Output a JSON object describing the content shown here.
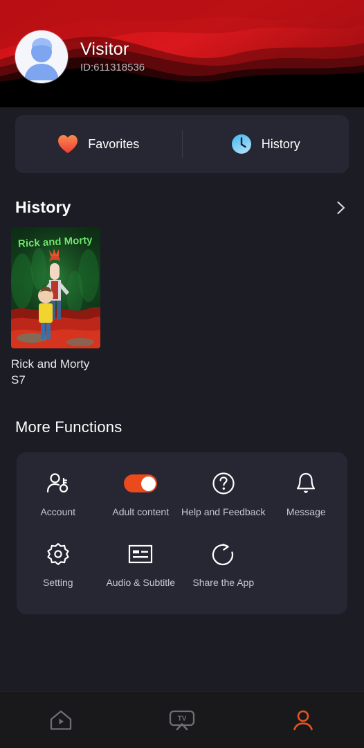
{
  "header": {
    "profile_name": "Visitor",
    "profile_id": "ID:611318536",
    "avatar_icon": "person-avatar-icon",
    "wave_colors": [
      "#d31116",
      "#b00f13",
      "#7d0c10",
      "#4a0709",
      "#000000"
    ]
  },
  "tabs": [
    {
      "label": "Favorites",
      "icon": "heart-icon",
      "color": "#f4623a"
    },
    {
      "label": "History",
      "icon": "clock-icon",
      "color": "#63c6f0"
    }
  ],
  "history_section": {
    "title": "History",
    "chevron_icon": "chevron-right-icon",
    "items": [
      {
        "title": "Rick and Morty S7",
        "poster_alt": "rick-and-morty-poster"
      }
    ]
  },
  "more_functions": {
    "title": "More Functions",
    "row1": [
      {
        "label": "Account",
        "icon": "person-key-icon",
        "type": "icon"
      },
      {
        "label": "Adult content",
        "icon": "toggle-switch-icon",
        "type": "toggle",
        "state": "on",
        "accent": "#ea4a1c"
      },
      {
        "label": "Help and Feedback",
        "icon": "question-circle-icon",
        "type": "icon"
      },
      {
        "label": "Message",
        "icon": "bell-icon",
        "type": "icon"
      }
    ],
    "row2": [
      {
        "label": "Setting",
        "icon": "gear-icon",
        "type": "icon"
      },
      {
        "label": "Audio & Subtitle",
        "icon": "subtitle-card-icon",
        "type": "icon"
      },
      {
        "label": "Share the App",
        "icon": "share-circle-arrow-icon",
        "type": "icon"
      }
    ]
  },
  "bottom_nav": [
    {
      "name": "home",
      "icon": "home-play-icon",
      "active": false,
      "color": "#6e6e74"
    },
    {
      "name": "tv",
      "icon": "tv-cast-icon",
      "active": false,
      "color": "#6e6e74"
    },
    {
      "name": "profile",
      "icon": "person-icon",
      "active": true,
      "color": "#e8531f"
    }
  ],
  "theme": {
    "page_bg": "#1b1c24",
    "card_bg": "#262733",
    "nav_bg": "#19191c",
    "accent": "#e8531f"
  }
}
